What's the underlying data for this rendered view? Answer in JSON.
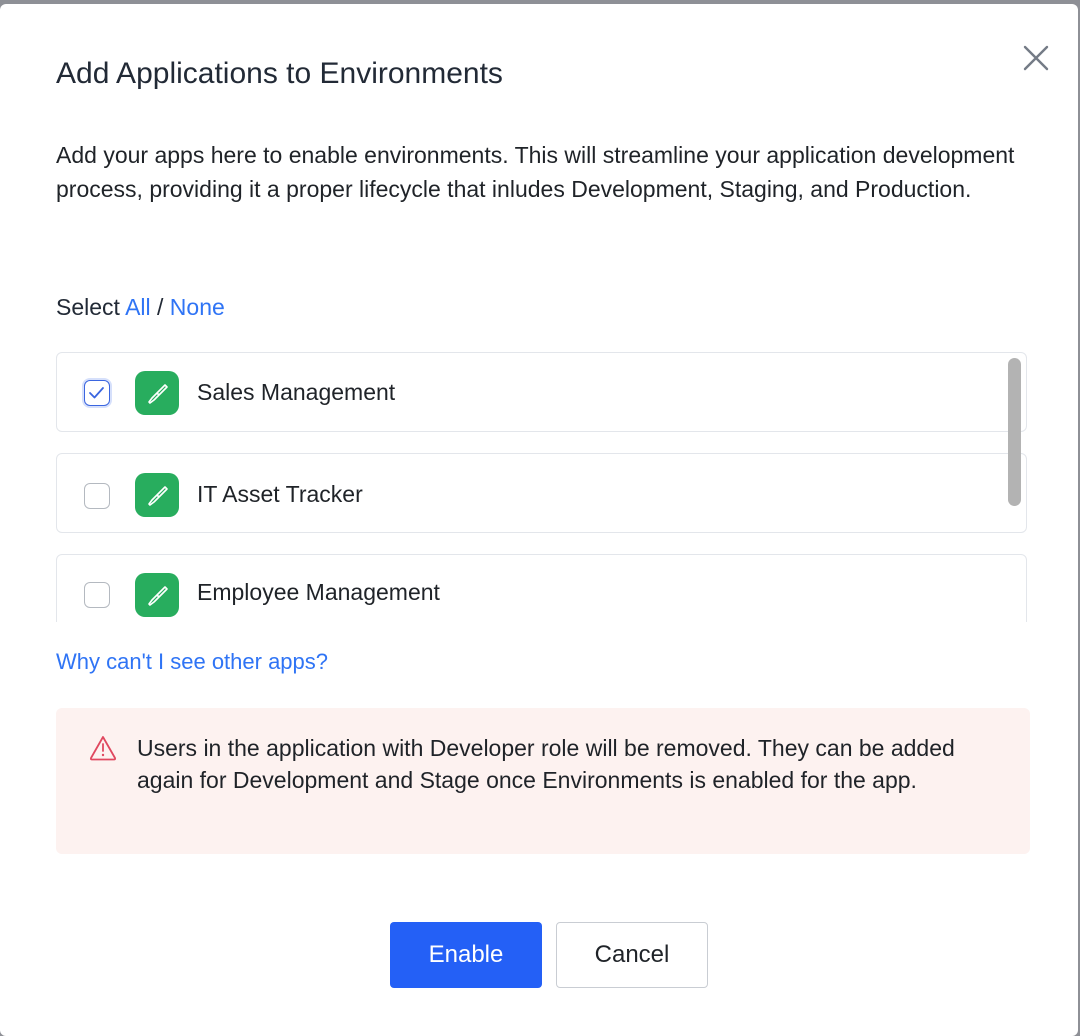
{
  "dialog": {
    "title": "Add Applications to Environments",
    "description": "Add your apps here to enable environments. This will streamline your application development process, providing it a proper lifecycle that inludes Development, Staging, and Production."
  },
  "select": {
    "prefix": "Select",
    "all": "All",
    "separator": "/",
    "none": "None"
  },
  "apps": [
    {
      "name": "Sales Management",
      "checked": true
    },
    {
      "name": "IT Asset Tracker",
      "checked": false
    },
    {
      "name": "Employee Management",
      "checked": false
    }
  ],
  "help_link": "Why can't I see other apps?",
  "warning": {
    "icon": "warning-triangle-icon",
    "text": "Users in the application with Developer role will be removed. They can be added again for Development and Stage once Environments is enabled for the app."
  },
  "buttons": {
    "enable": "Enable",
    "cancel": "Cancel"
  },
  "colors": {
    "primary": "#2460f6",
    "link": "#2f74f5",
    "app_icon_bg": "#28ad5e",
    "warning_bg": "#fdf2f0",
    "warning_icon": "#e0485f"
  }
}
